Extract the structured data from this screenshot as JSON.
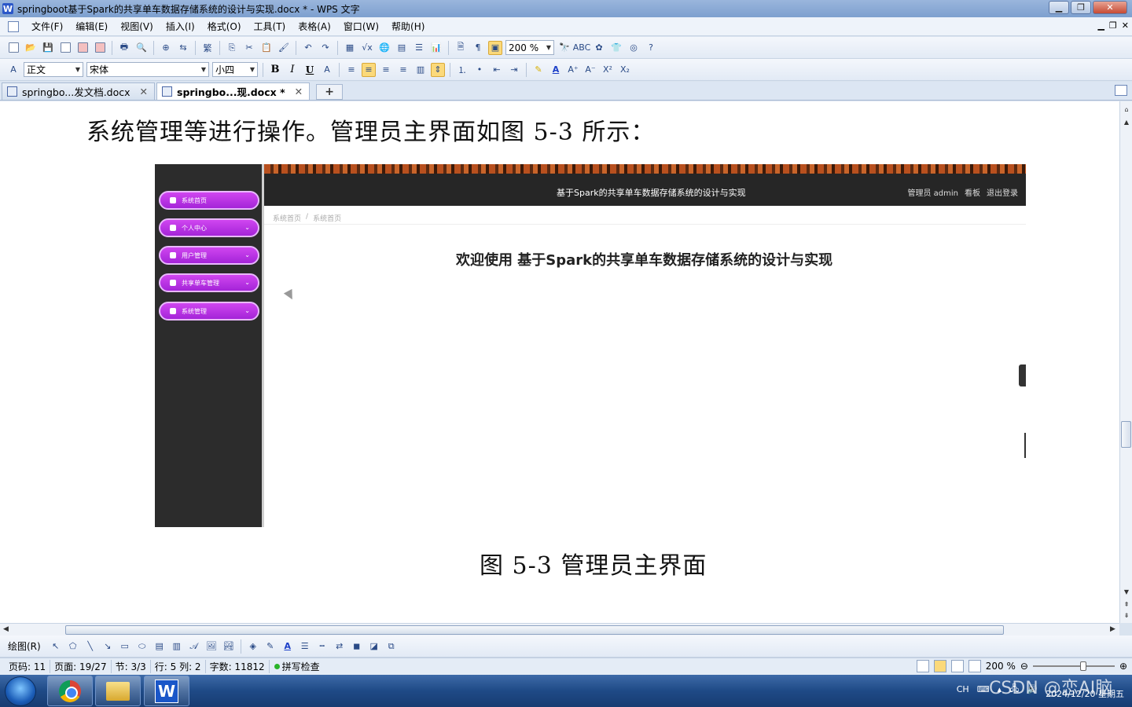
{
  "window": {
    "title": "springboot基于Spark的共享单车数据存储系统的设计与实现.docx * - WPS 文字",
    "app_icon_letter": "W"
  },
  "menu": [
    "文件(F)",
    "编辑(E)",
    "视图(V)",
    "插入(I)",
    "格式(O)",
    "工具(T)",
    "表格(A)",
    "窗口(W)",
    "帮助(H)"
  ],
  "toolbar": {
    "zoom_value": "200 %",
    "style_value": "正文",
    "font_value": "宋体",
    "size_value": "小四"
  },
  "tabs": [
    {
      "label": "springbo...发文档.docx",
      "active": false
    },
    {
      "label": "springbo...现.docx *",
      "active": true
    }
  ],
  "document": {
    "paragraph": "系统管理等进行操作。管理员主界面如图 5-3 所示：",
    "caption": "图 5-3 管理员主界面",
    "embedded": {
      "banner_title": "基于Spark的共享单车数据存储系统的设计与实现",
      "user_info": "管理员 admin",
      "dashboard_link": "看板",
      "logout_link": "退出登录",
      "breadcrumb": [
        "系统首页",
        "系统首页"
      ],
      "welcome": "欢迎使用 基于Spark的共享单车数据存储系统的设计与实现",
      "nav": [
        {
          "label": "系统首页",
          "has_arrow": false
        },
        {
          "label": "个人中心",
          "has_arrow": true
        },
        {
          "label": "用户管理",
          "has_arrow": true
        },
        {
          "label": "共享单车管理",
          "has_arrow": true
        },
        {
          "label": "系统管理",
          "has_arrow": true
        }
      ]
    }
  },
  "drawbar": {
    "label": "绘图(R)"
  },
  "status": {
    "page_code": "页码: 11",
    "page": "页面: 19/27",
    "section": "节: 3/3",
    "row_col": "行: 5  列: 2",
    "word_count": "字数: 11812",
    "spell": "拼写检查",
    "zoom": "200 %"
  },
  "taskbar": {
    "ime": "CH",
    "date": "2024/12/20 星期五",
    "watermark": "CSDN @恋AI脑"
  }
}
